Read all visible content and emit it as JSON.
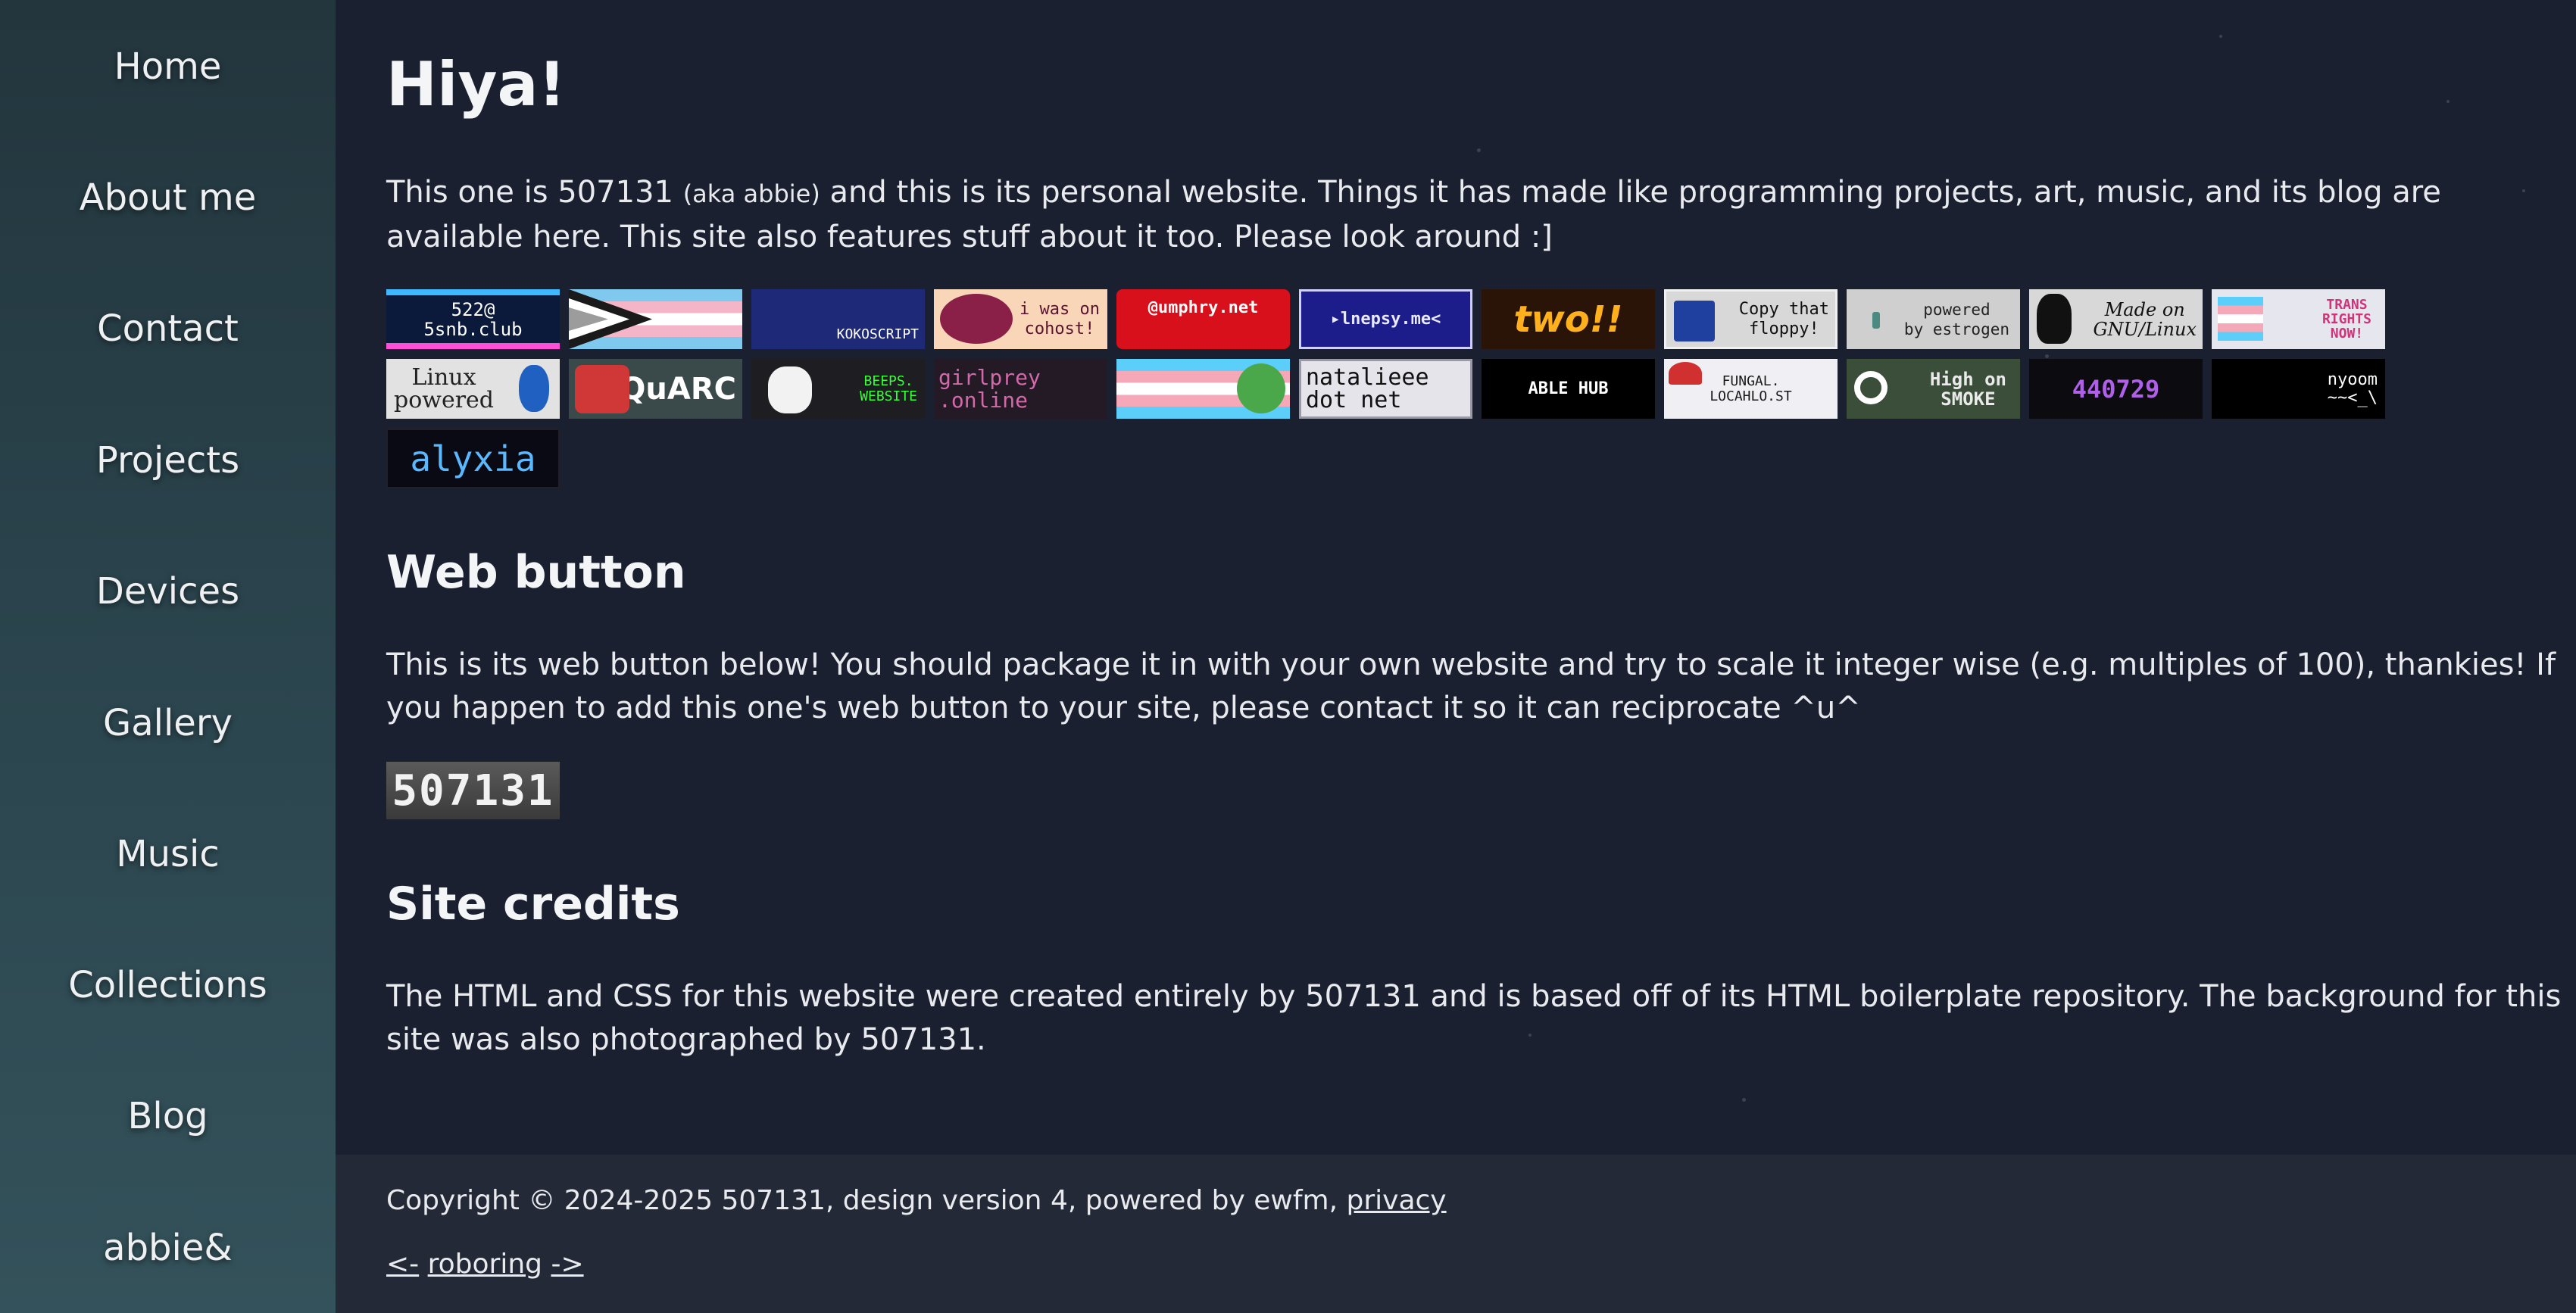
{
  "sidebar": {
    "items": [
      {
        "label": "Home"
      },
      {
        "label": "About me"
      },
      {
        "label": "Contact"
      },
      {
        "label": "Projects"
      },
      {
        "label": "Devices"
      },
      {
        "label": "Gallery"
      },
      {
        "label": "Music"
      },
      {
        "label": "Collections"
      },
      {
        "label": "Blog"
      },
      {
        "label": "abbie&"
      }
    ]
  },
  "main": {
    "title": "Hiya!",
    "intro": {
      "before": "This one is 507131 ",
      "aka": "(aka abbie)",
      "after": " and this is its personal website. Things it has made like programming projects, art, music, and its blog are available here. This site also features stuff about it too. Please look around :]"
    },
    "buttons": [
      {
        "text": "522@\n5snb.club",
        "icon": "5snb-club-button"
      },
      {
        "text": "",
        "icon": "demigirl-flag-trans-flag-button"
      },
      {
        "text": "KOKOSCRIPT",
        "icon": "kokoscript-button"
      },
      {
        "text": "i was on\ncohost!",
        "icon": "cohost-bug-button"
      },
      {
        "text": "@umphry.net",
        "icon": "umphry-net-button"
      },
      {
        "text": "▸lnepsy.me<",
        "icon": "lnepsy-me-button"
      },
      {
        "text": "two!!",
        "icon": "two-button"
      },
      {
        "text": "Copy that\nfloppy!",
        "icon": "floppy-disk-button"
      },
      {
        "text": "powered\nby estrogen",
        "icon": "estrogen-button"
      },
      {
        "text": "Made on\nGNU/Linux",
        "icon": "gnu-linux-tux-button"
      },
      {
        "text": "TRANS\nRIGHTS\nNOW!",
        "icon": "trans-rights-now-button"
      },
      {
        "text": "Linux\npowered",
        "icon": "linux-powered-button"
      },
      {
        "text": "QuARC",
        "icon": "quarc-button"
      },
      {
        "text": "BEEPS.\nWEBSITE",
        "icon": "beeps-website-button"
      },
      {
        "text": "girlprey\n.online",
        "icon": "girlprey-online-button"
      },
      {
        "text": "",
        "icon": "trans-flag-bush-button"
      },
      {
        "text": "natalieee\ndot net",
        "icon": "natalieee-dot-net-button"
      },
      {
        "text": "ABLE HUB",
        "icon": "able-hub-button"
      },
      {
        "text": "FUNGAL.\nLOCAHLO.ST",
        "icon": "fungal-mushroom-button"
      },
      {
        "text": "High on\nSMOKE",
        "icon": "high-on-smoke-button"
      },
      {
        "text": "440729",
        "icon": "440729-button"
      },
      {
        "text": "nyoom\n~~<_\\",
        "icon": "nyoom-button"
      },
      {
        "text": "alyxia",
        "icon": "alyxia-button"
      }
    ],
    "web_button": {
      "heading": "Web button",
      "text": "This is its web button below! You should package it in with your own website and try to scale it integer wise (e.g. multiples of 100), thankies! If you happen to add this one's web button to your site, please contact it so it can reciprocate ^u^",
      "button_label": "507131"
    },
    "credits": {
      "heading": "Site credits",
      "text": "The HTML and CSS for this website were created entirely by 507131 and is based off of its HTML boilerplate repository. The background for this site was also photographed by 507131."
    }
  },
  "footer": {
    "copyright": "Copyright © 2024-2025 507131, design version 4, powered by ewfm, ",
    "privacy": "privacy",
    "prev": "<-",
    "ring": "roboring",
    "next": "->"
  },
  "colors": {
    "background": "#1b2030",
    "sidebar_top": "#23353d",
    "sidebar_bottom": "#34525b",
    "footer": "#232937",
    "text": "#e8eaee"
  }
}
